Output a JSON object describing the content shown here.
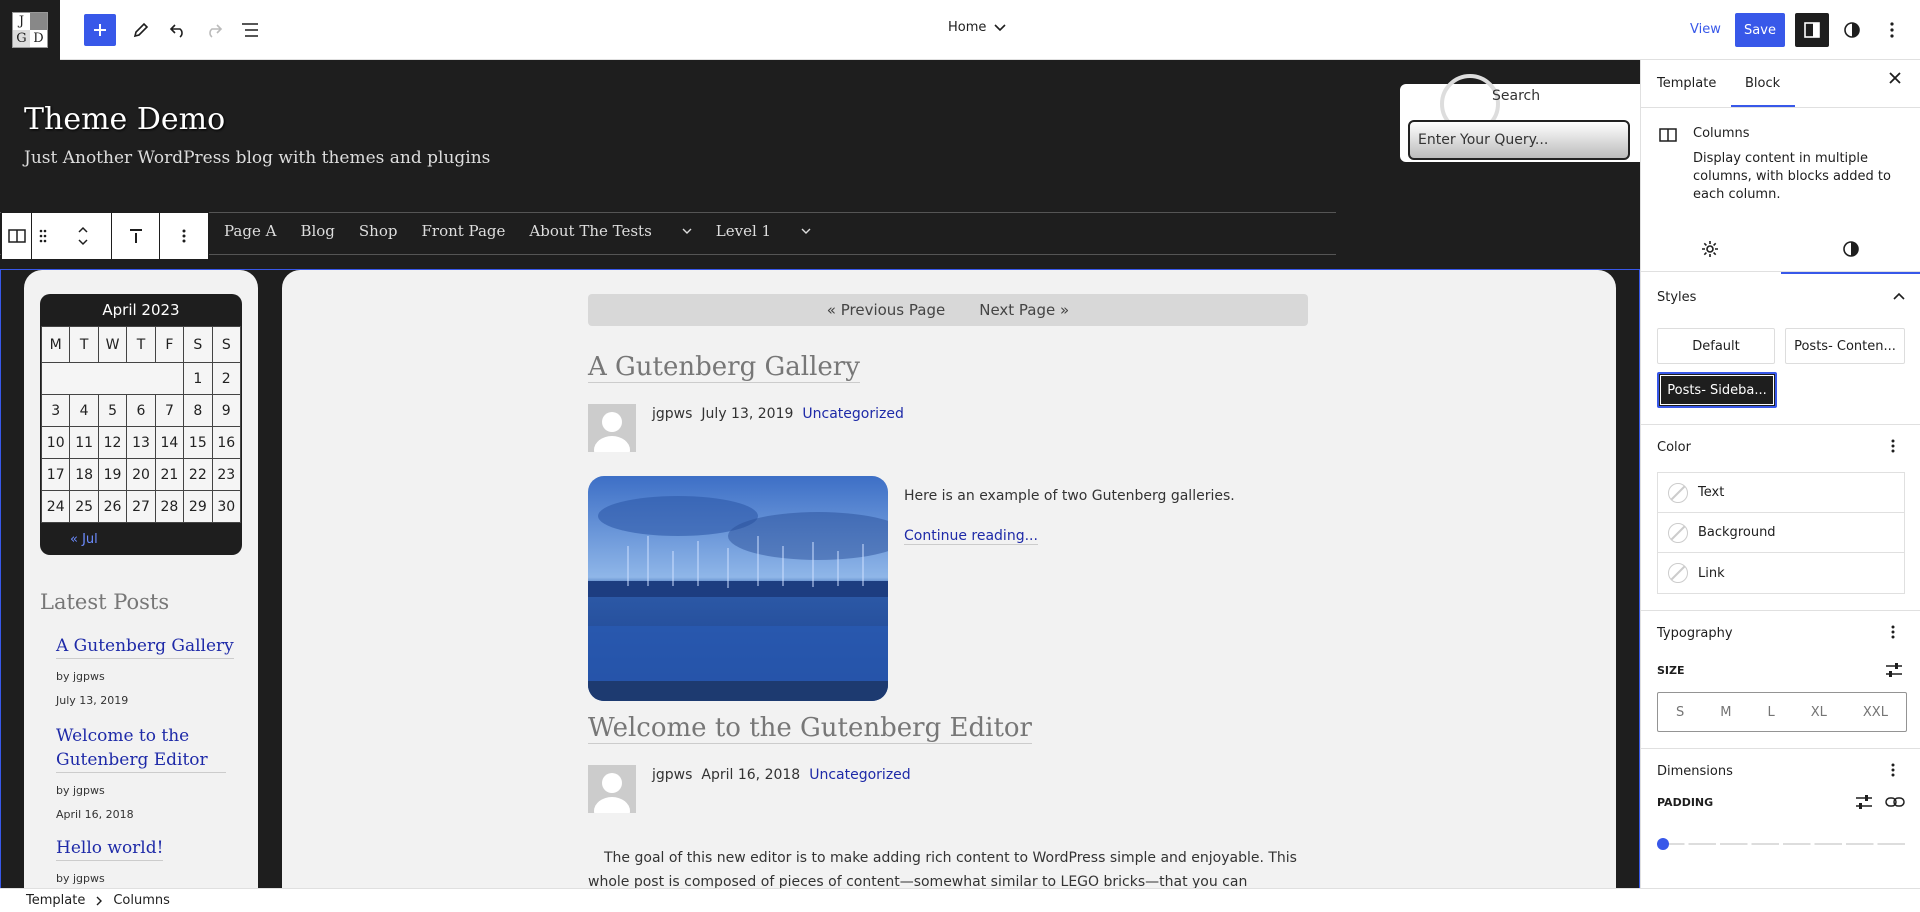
{
  "topbar": {
    "logo_letters": [
      "J",
      "",
      "G",
      "D"
    ],
    "page_selector": "Home",
    "view_label": "View",
    "save_label": "Save"
  },
  "site": {
    "title": "Theme Demo",
    "tagline": "Just Another WordPress blog with themes and plugins"
  },
  "search": {
    "label": "Search",
    "placeholder": "Enter Your Query..."
  },
  "nav": {
    "items": [
      "Page A",
      "Blog",
      "Shop",
      "Front Page",
      "About The Tests",
      "Level 1"
    ]
  },
  "calendar": {
    "caption": "April 2023",
    "headers": [
      "M",
      "T",
      "W",
      "T",
      "F",
      "S",
      "S"
    ],
    "weeks": [
      [
        "",
        "",
        "",
        "",
        "",
        "1",
        "2"
      ],
      [
        "3",
        "4",
        "5",
        "6",
        "7",
        "8",
        "9"
      ],
      [
        "10",
        "11",
        "12",
        "13",
        "14",
        "15",
        "16"
      ],
      [
        "17",
        "18",
        "19",
        "20",
        "21",
        "22",
        "23"
      ],
      [
        "24",
        "25",
        "26",
        "27",
        "28",
        "29",
        "30"
      ]
    ],
    "prev_link": "« Jul"
  },
  "latest_posts": {
    "heading": "Latest Posts",
    "items": [
      {
        "title": "A Gutenberg Gallery",
        "author": "by jgpws",
        "date": "July 13, 2019"
      },
      {
        "title": "Welcome to the Gutenberg Editor",
        "author": "by jgpws",
        "date": "April 16, 2018"
      },
      {
        "title": "Hello world!",
        "author": "by jgpws",
        "date": ""
      }
    ]
  },
  "main": {
    "prev_page": "Previous Page",
    "next_page": "Next Page",
    "posts": [
      {
        "title": "A Gutenberg Gallery",
        "author": "jgpws",
        "date": "July 13, 2019",
        "category": "Uncategorized",
        "excerpt": "Here is an example of two Gutenberg galleries.",
        "continue": "Continue reading..."
      },
      {
        "title": "Welcome to the Gutenberg Editor",
        "author": "jgpws",
        "date": "April 16, 2018",
        "category": "Uncategorized",
        "body": "The goal of this new editor is to make adding rich content to WordPress simple and enjoyable. This whole post is composed of pieces of content—somewhat similar to LEGO bricks—that you can"
      }
    ]
  },
  "panel": {
    "tabs": [
      "Template",
      "Block"
    ],
    "block_name": "Columns",
    "block_desc": "Display content in multiple columns, with blocks added to each column.",
    "styles_heading": "Styles",
    "styles": [
      "Default",
      "Posts- Conten...",
      "Posts- Sideba..."
    ],
    "color_heading": "Color",
    "color_items": [
      "Text",
      "Background",
      "Link"
    ],
    "typography_heading": "Typography",
    "size_label": "SIZE",
    "sizes": [
      "S",
      "M",
      "L",
      "XL",
      "XXL"
    ],
    "dimensions_heading": "Dimensions",
    "padding_label": "PADDING",
    "padding_value": 0
  },
  "footer": {
    "crumbs": [
      "Template",
      "Columns"
    ]
  },
  "colors": {
    "accent": "#3858e9",
    "dark": "#1e1e1e",
    "link": "#1e2aa8"
  }
}
